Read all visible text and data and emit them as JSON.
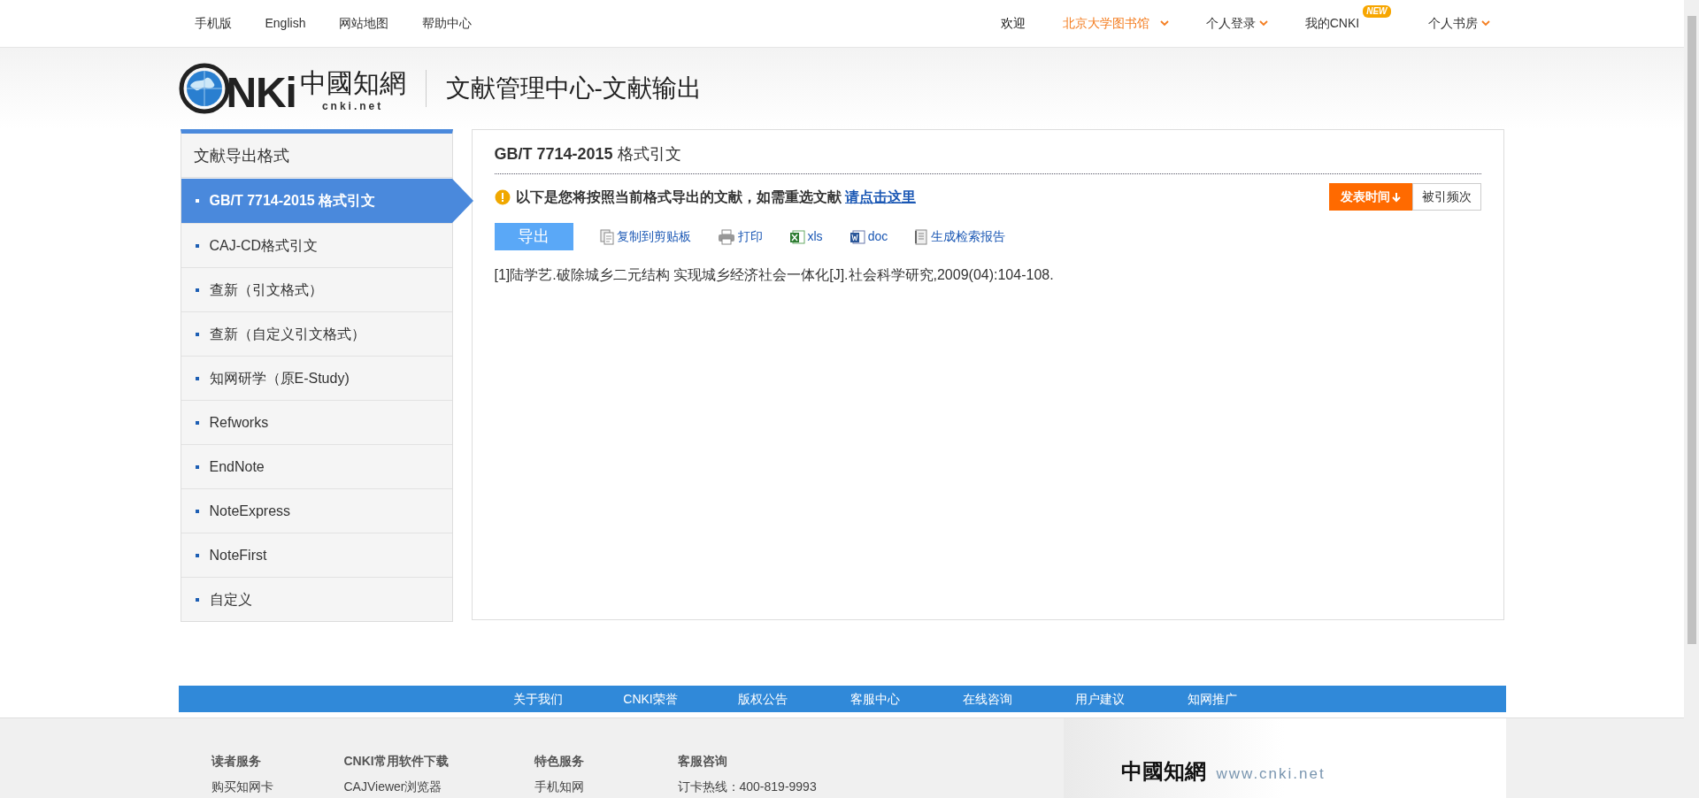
{
  "top_bar": {
    "left_links": [
      "手机版",
      "English",
      "网站地图",
      "帮助中心"
    ],
    "right_items": [
      {
        "label": "欢迎",
        "kind": "text"
      },
      {
        "label": "北京大学图书馆",
        "kind": "highlight-dropdown"
      },
      {
        "label": "个人登录",
        "kind": "dropdown"
      },
      {
        "label": "我的CNKI",
        "kind": "badge",
        "badge": "NEW"
      },
      {
        "label": "个人书房",
        "kind": "dropdown"
      }
    ]
  },
  "header": {
    "logo": {
      "wordmark": "NKi",
      "chinese": "中國知網",
      "domain": "cnki.net"
    },
    "title": "文献管理中心-文献输出"
  },
  "sidebar": {
    "title": "文献导出格式",
    "items": [
      {
        "label": "GB/T 7714-2015 格式引文",
        "selected": true
      },
      {
        "label": "CAJ-CD格式引文",
        "selected": false
      },
      {
        "label": "查新（引文格式）",
        "selected": false
      },
      {
        "label": "查新（自定义引文格式）",
        "selected": false
      },
      {
        "label": "知网研学（原E-Study)",
        "selected": false
      },
      {
        "label": "Refworks",
        "selected": false
      },
      {
        "label": "EndNote",
        "selected": false
      },
      {
        "label": "NoteExpress",
        "selected": false
      },
      {
        "label": "NoteFirst",
        "selected": false
      },
      {
        "label": "自定义",
        "selected": false
      }
    ]
  },
  "main": {
    "title_bold": "GB/T 7714-2015",
    "title_rest": "格式引文",
    "notice": "以下是您将按照当前格式导出的文献，如需重选文献",
    "notice_link": "请点击这里",
    "sort_buttons": [
      {
        "label": "发表时间",
        "selected": true
      },
      {
        "label": "被引频次",
        "selected": false
      }
    ],
    "export_button": "导出",
    "tools": [
      {
        "label": "复制到剪贴板",
        "kind": "copy"
      },
      {
        "label": "打印",
        "kind": "print"
      },
      {
        "label": "xls",
        "kind": "xls"
      },
      {
        "label": "doc",
        "kind": "doc"
      },
      {
        "label": "生成检索报告",
        "kind": "report"
      }
    ],
    "citations": [
      "[1]陆学艺.破除城乡二元结构 实现城乡经济社会一体化[J].社会科学研究,2009(04):104-108."
    ]
  },
  "footer": {
    "nav": [
      "关于我们",
      "CNKI荣誉",
      "版权公告",
      "客服中心",
      "在线咨询",
      "用户建议",
      "知网推广"
    ],
    "columns": [
      {
        "heading": "读者服务",
        "links": [
          "购买知网卡"
        ]
      },
      {
        "heading": "CNKI常用软件下载",
        "links": [
          "CAJViewer浏览器"
        ]
      },
      {
        "heading": "特色服务",
        "links": [
          "手机知网"
        ]
      },
      {
        "heading": "客服咨询",
        "links": [
          "订卡热线：400-819-9993"
        ]
      }
    ],
    "logo": {
      "chinese": "中國知網",
      "domain": "www.cnki.net"
    }
  }
}
